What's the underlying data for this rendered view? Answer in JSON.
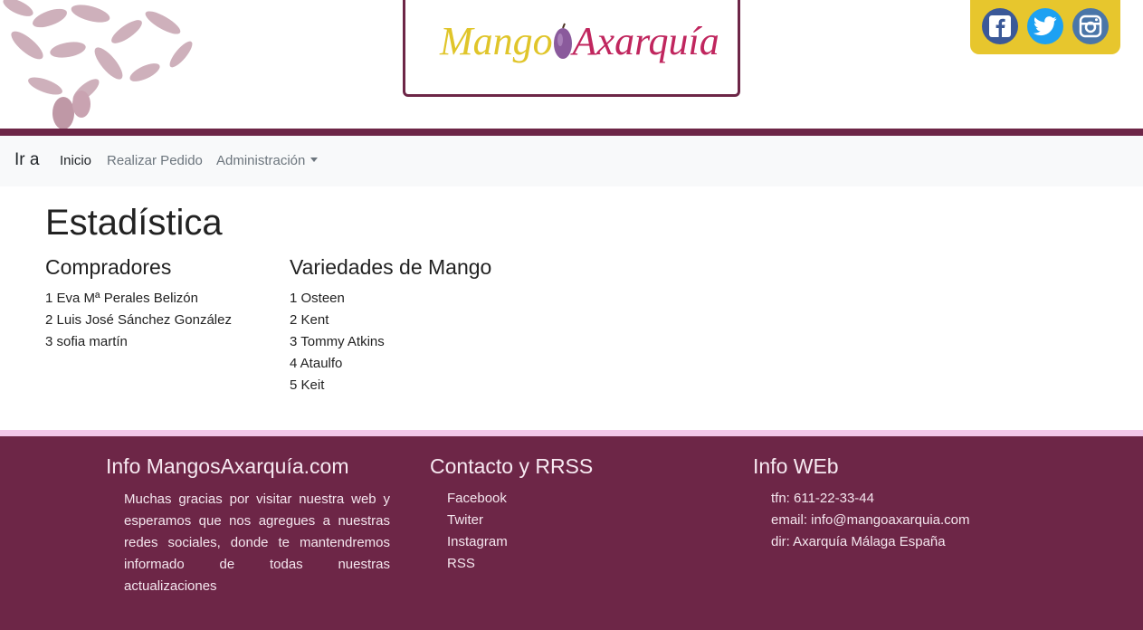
{
  "header": {
    "logo": {
      "part1": "Mango",
      "part2": "Axarquía"
    },
    "social": [
      {
        "name": "facebook",
        "color": "#3b5998",
        "icon": "facebook-icon"
      },
      {
        "name": "twitter",
        "color": "#1da1f2",
        "icon": "twitter-icon"
      },
      {
        "name": "instagram",
        "color": "#4a76a8",
        "icon": "instagram-icon"
      }
    ]
  },
  "nav": {
    "brand": "Ir a",
    "links": [
      "Inicio",
      "Realizar Pedido",
      "Administración"
    ]
  },
  "main": {
    "title": "Estadística",
    "buyers": {
      "heading": "Compradores",
      "items": [
        "1 Eva Mª Perales Belizón",
        "2 Luis José Sánchez González",
        "3 sofia martín"
      ]
    },
    "varieties": {
      "heading": "Variedades de Mango",
      "items": [
        "1 Osteen",
        "2 Kent",
        "3 Tommy Atkins",
        "4 Ataulfo",
        "5 Keit"
      ]
    }
  },
  "footer": {
    "info": {
      "heading": "Info MangosAxarquía.com",
      "text": "Muchas gracias por visitar nuestra web y esperamos que nos agregues a nuestras redes sociales, donde te mantendremos informado de todas nuestras actualizaciones"
    },
    "contact": {
      "heading": "Contacto y RRSS",
      "links": [
        "Facebook",
        "Twiter",
        "Instagram",
        "RSS"
      ]
    },
    "web": {
      "heading": "Info WEb",
      "lines": [
        "tfn: 611-22-33-44",
        "email: info@mangoaxarquia.com",
        "dir: Axarquía Málaga España"
      ]
    }
  },
  "colors": {
    "brand": "#6d2647",
    "accent": "#e7c62d",
    "footer_rule": "#f2c7e8"
  }
}
